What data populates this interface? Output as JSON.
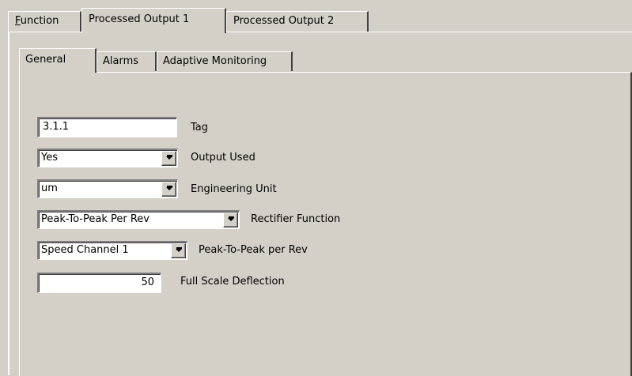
{
  "outer_tabs": [
    {
      "label_mnemonic": "F",
      "label_rest": "unction"
    },
    {
      "label": "Processed Output 1"
    },
    {
      "label": "Processed Output 2"
    }
  ],
  "inner_tabs": [
    {
      "label": "General"
    },
    {
      "label": "Alarms"
    },
    {
      "label": "Adaptive Monitoring"
    }
  ],
  "fields": {
    "tag": {
      "value": "3.1.1",
      "label": "Tag"
    },
    "output_used": {
      "value": "Yes",
      "label": "Output Used"
    },
    "engineering_unit": {
      "value": "um",
      "label": "Engineering Unit"
    },
    "rectifier_function": {
      "value": "Peak-To-Peak Per Rev",
      "label": "Rectifier Function"
    },
    "peak_to_peak": {
      "value": "Speed Channel 1",
      "label": "Peak-To-Peak per Rev"
    },
    "full_scale": {
      "value": "50",
      "label": "Full Scale Deflection"
    }
  },
  "icons": {
    "dropdown": "chevron-down-icon"
  }
}
